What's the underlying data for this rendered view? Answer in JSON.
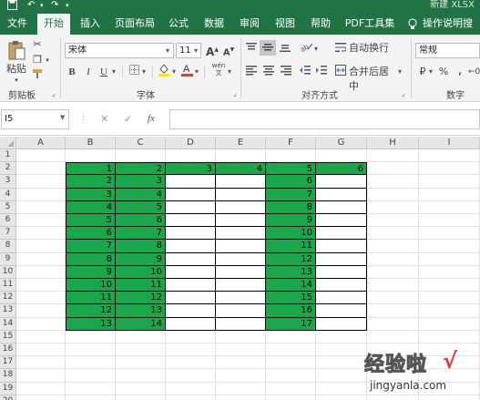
{
  "titlebar": {
    "save_icon": "save-icon",
    "undo_glyph": "↶",
    "redo_glyph": "↷",
    "doc_title": "新建 XLSX"
  },
  "tabs": [
    "文件",
    "开始",
    "插入",
    "页面布局",
    "公式",
    "数据",
    "审阅",
    "视图",
    "帮助",
    "PDF工具集",
    "操作说明搜索"
  ],
  "active_tab": "开始",
  "ribbon": {
    "clipboard": {
      "paste": "粘贴",
      "label": "剪贴板"
    },
    "font": {
      "name": "宋体",
      "size": "11",
      "grow": "A",
      "shrink": "A",
      "bold": "B",
      "italic": "I",
      "underline": "U",
      "label": "字体",
      "wen": "wén"
    },
    "alignment": {
      "wrap": "自动换行",
      "merge": "合并后居中",
      "label": "对齐方式"
    },
    "number": {
      "format": "常规",
      "currency": "₽",
      "percent": "%",
      "comma": ",",
      "label": "数字"
    }
  },
  "formula_bar": {
    "name_box": "I5",
    "cancel": "✕",
    "enter": "✓",
    "fx": "fx",
    "formula": ""
  },
  "columns": [
    "A",
    "B",
    "C",
    "D",
    "E",
    "F",
    "G",
    "H",
    "I"
  ],
  "rows": [
    "1",
    "2",
    "3",
    "4",
    "5",
    "6",
    "7",
    "8",
    "9",
    "10",
    "11",
    "12",
    "13",
    "14",
    "15",
    "16",
    "17",
    "18",
    "19",
    "20"
  ],
  "cells": {
    "B": [
      "1",
      "2",
      "3",
      "4",
      "5",
      "6",
      "7",
      "8",
      "9",
      "10",
      "11",
      "12",
      "13"
    ],
    "C": [
      "2",
      "3",
      "4",
      "5",
      "6",
      "7",
      "8",
      "9",
      "10",
      "11",
      "12",
      "13",
      "14"
    ],
    "D": [
      "3"
    ],
    "E": [
      "4"
    ],
    "F": [
      "5",
      "6",
      "7",
      "8",
      "9",
      "10",
      "11",
      "12",
      "13",
      "14",
      "15",
      "16",
      "17"
    ],
    "G": [
      "6"
    ]
  },
  "colors": {
    "excel_green": "#217346",
    "cell_fill": "#1aa64a",
    "font_red": "#e53935",
    "fill_yellow": "#ffe600"
  },
  "watermark": {
    "line1": "经验啦",
    "line2": "jingyanla.com",
    "check": "√"
  }
}
